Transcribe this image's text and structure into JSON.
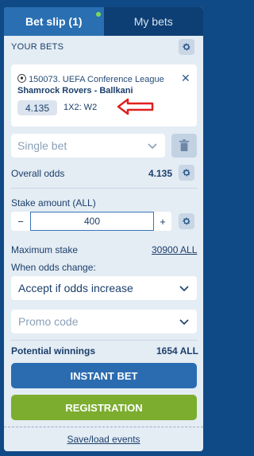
{
  "tabs": {
    "bet_slip": "Bet slip (1)",
    "my_bets": "My bets"
  },
  "your_bets": {
    "title": "YOUR BETS"
  },
  "bet": {
    "league": "150073. UEFA Conference League",
    "match": "Shamrock Rovers - Ballkani",
    "odds": "4.135",
    "market": "1X2: W2"
  },
  "bet_type": {
    "selected": "Single bet"
  },
  "overall_odds": {
    "label": "Overall odds",
    "value": "4.135"
  },
  "stake": {
    "label": "Stake amount (ALL)",
    "minus": "−",
    "value": "400",
    "plus": "+"
  },
  "max_stake": {
    "label": "Maximum stake",
    "value": "30900 ALL"
  },
  "odds_change": {
    "label": "When odds change:",
    "selected": "Accept if odds increase"
  },
  "promo": {
    "placeholder": "Promo code"
  },
  "potential": {
    "label": "Potential winnings",
    "value": "1654 ALL"
  },
  "buttons": {
    "instant_bet": "INSTANT BET",
    "registration": "REGISTRATION",
    "save_load": "Save/load events"
  },
  "colors": {
    "instant_bet": "#2b6cb0",
    "registration": "#7cad2f",
    "arrow": "#e02020"
  }
}
